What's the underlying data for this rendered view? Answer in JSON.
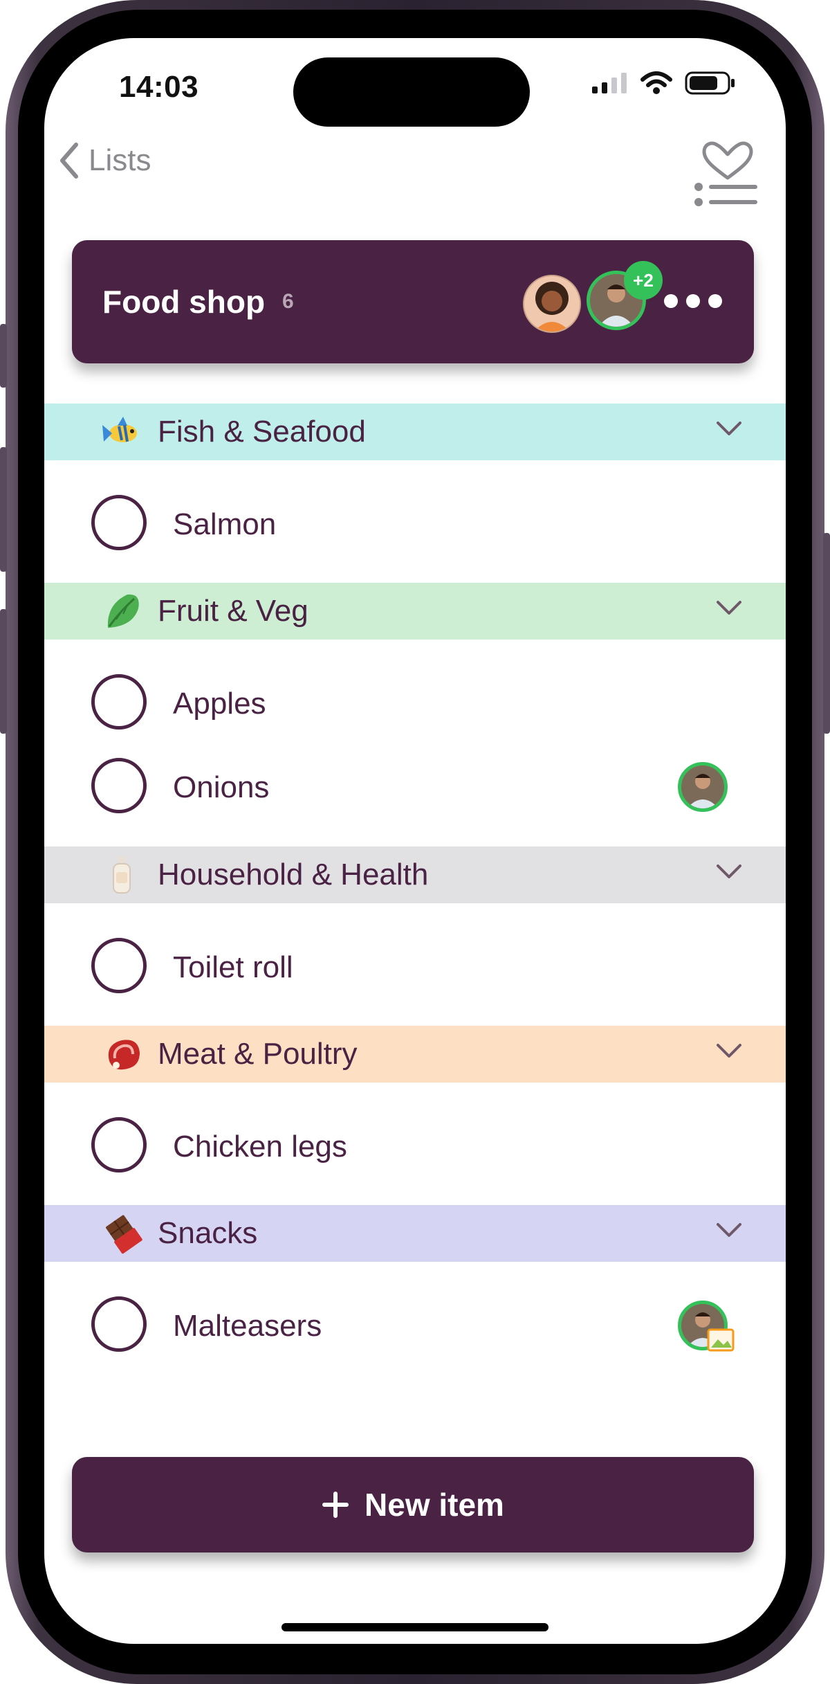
{
  "status_bar": {
    "time": "14:03",
    "icons": [
      "signal-icon",
      "wifi-icon",
      "battery-icon"
    ]
  },
  "nav": {
    "back_label": "Lists",
    "back_icon": "chevron-left-icon",
    "right_icon": "favorites-list-icon"
  },
  "list_header": {
    "title": "Food shop",
    "count": "6",
    "extra_members_badge": "+2",
    "background": "#4a2244"
  },
  "sections": [
    {
      "title": "Fish & Seafood",
      "icon": "tropical-fish-icon",
      "color": "#c0efeb",
      "items": [
        {
          "label": "Salmon",
          "assignee": false
        }
      ]
    },
    {
      "title": "Fruit & Veg",
      "icon": "leafy-green-icon",
      "color": "#cdeed3",
      "items": [
        {
          "label": "Apples",
          "assignee": false
        },
        {
          "label": "Onions",
          "assignee": true
        }
      ]
    },
    {
      "title": "Household & Health",
      "icon": "lotion-bottle-icon",
      "color": "#e1e1e3",
      "items": [
        {
          "label": "Toilet roll",
          "assignee": false
        }
      ]
    },
    {
      "title": "Meat & Poultry",
      "icon": "cut-of-meat-icon",
      "color": "#fde0c3",
      "items": [
        {
          "label": "Chicken legs",
          "assignee": false
        }
      ]
    },
    {
      "title": "Snacks",
      "icon": "chocolate-bar-icon",
      "color": "#d5d4f3",
      "items": [
        {
          "label": "Malteasers",
          "assignee": true
        }
      ]
    }
  ],
  "new_item_button": {
    "label": "New item",
    "icon": "plus-icon"
  },
  "colors": {
    "accent": "#4a2244",
    "assignee_ring": "#35c15a",
    "back_gray": "#8a8a8e"
  }
}
